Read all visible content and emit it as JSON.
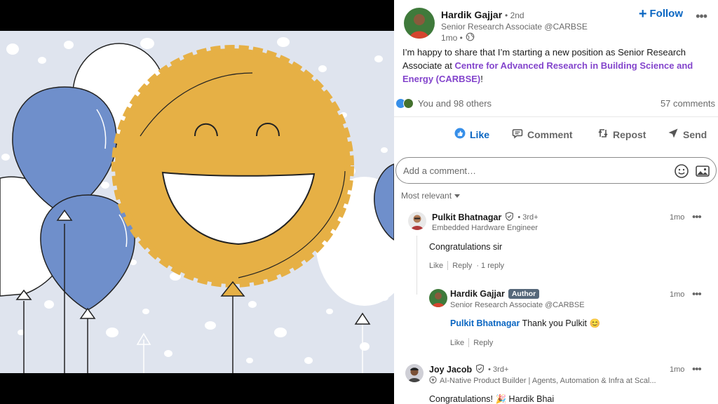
{
  "post": {
    "author": {
      "name": "Hardik Gajjar",
      "degree": "• 2nd",
      "headline": "Senior Research Associate @CARBSE",
      "time": "1mo •"
    },
    "follow_label": "Follow",
    "text_before": "I’m happy to share that I’m starting a new position as Senior Research Associate at ",
    "mention": "Centre for Advanced Research in Building Science and Energy (CARBSE)",
    "text_after": "!",
    "reactions_text": "You and 98 others",
    "comments_count": "57 comments"
  },
  "actions": {
    "like": "Like",
    "comment": "Comment",
    "repost": "Repost",
    "send": "Send"
  },
  "comment_box": {
    "placeholder": "Add a comment…"
  },
  "sort_label": "Most relevant",
  "comments": [
    {
      "name": "Pulkit Bhatnagar",
      "degree": "• 3rd+",
      "headline": "Embedded Hardware Engineer",
      "time": "1mo",
      "text": "Congratulations sir",
      "like_label": "Like",
      "reply_label": "Reply",
      "reply_count": "· 1 reply"
    },
    {
      "name": "Hardik Gajjar",
      "badge": "Author",
      "headline": "Senior Research Associate @CARBSE",
      "time": "1mo",
      "mention": "Pulkit Bhatnagar",
      "text": "Thank you Pulkit 😊",
      "like_label": "Like",
      "reply_label": "Reply"
    },
    {
      "name": "Joy Jacob",
      "degree": "• 3rd+",
      "headline": "AI-Native Product Builder | Agents, Automation & Infra at Scal...",
      "time": "1mo",
      "text": "Congratulations! 🎉 Hardik Bhai"
    }
  ]
}
